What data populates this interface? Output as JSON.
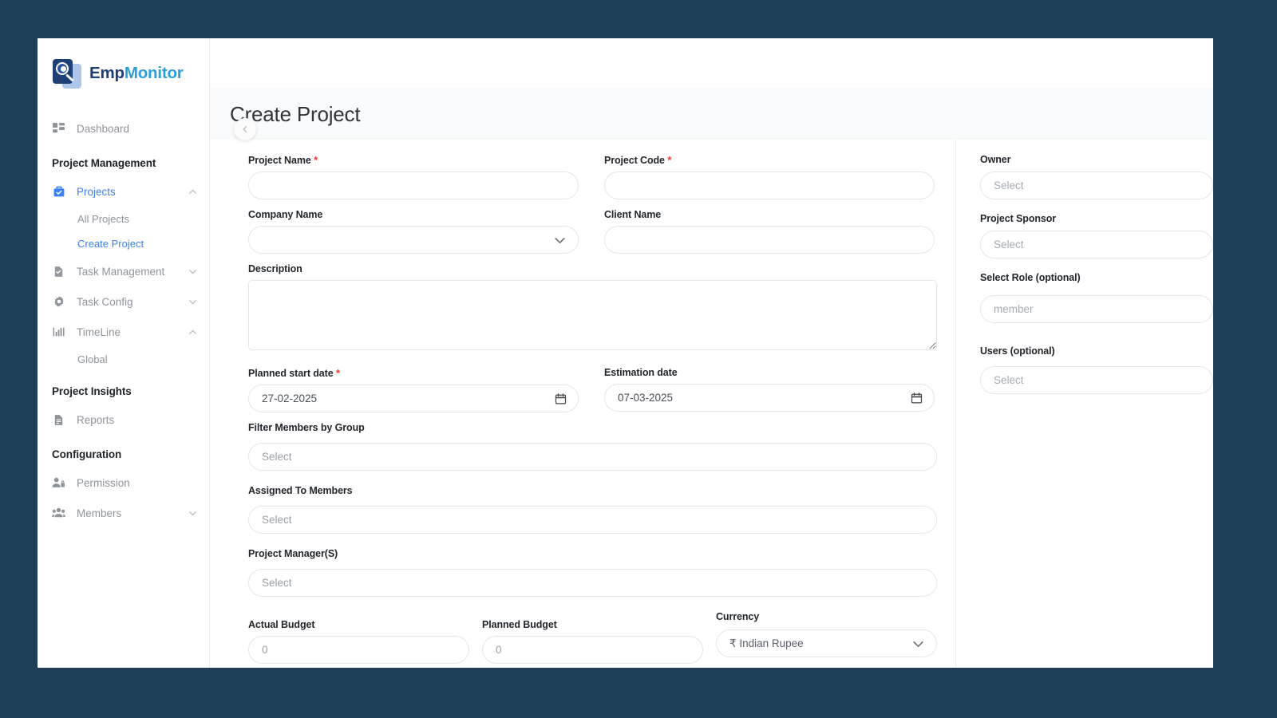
{
  "theme": {
    "outer_background": "#1c4156",
    "accent": "#3b82f6",
    "required_star": "#e8392c",
    "brand_dark": "#1f3f77",
    "brand_light": "#2a9fd8"
  },
  "brand": {
    "name_part1": "Emp",
    "name_part2": "Monitor",
    "logo_icon": "magnifier-person-icon"
  },
  "sidebar": {
    "collapse_icon": "chevron-left-icon",
    "items": [
      {
        "label": "Dashboard",
        "icon": "dashboard-grid-icon",
        "type": "link",
        "active": false,
        "chevron": ""
      }
    ],
    "sections": [
      {
        "title": "Project Management",
        "items": [
          {
            "label": "Projects",
            "icon": "briefcase-check-icon",
            "active": true,
            "chevron": "chevron-up-icon"
          },
          {
            "label": "All Projects",
            "sub": true,
            "current": false
          },
          {
            "label": "Create Project",
            "sub": true,
            "current": true
          },
          {
            "label": "Task Management",
            "icon": "document-check-icon",
            "active": false,
            "chevron": "chevron-down-icon"
          },
          {
            "label": "Task Config",
            "icon": "gear-icon",
            "active": false,
            "chevron": "chevron-down-icon"
          },
          {
            "label": "TimeLine",
            "icon": "bar-chart-icon",
            "active": false,
            "chevron": "chevron-up-icon"
          },
          {
            "label": "Global",
            "sub": true,
            "current": false
          }
        ]
      },
      {
        "title": "Project Insights",
        "items": [
          {
            "label": "Reports",
            "icon": "report-document-icon",
            "active": false,
            "chevron": ""
          }
        ]
      },
      {
        "title": "Configuration",
        "items": [
          {
            "label": "Permission",
            "icon": "user-lock-icon",
            "active": false,
            "chevron": ""
          },
          {
            "label": "Members",
            "icon": "users-group-icon",
            "active": false,
            "chevron": "chevron-down-icon"
          }
        ]
      }
    ]
  },
  "page": {
    "title": "Create Project"
  },
  "form": {
    "project_name": {
      "label": "Project Name",
      "required": true,
      "value": "",
      "placeholder": ""
    },
    "project_code": {
      "label": "Project Code",
      "required": true,
      "value": "",
      "placeholder": ""
    },
    "company_name": {
      "label": "Company Name",
      "required": false,
      "value": "",
      "placeholder": "",
      "icon": "chevron-down-icon"
    },
    "client_name": {
      "label": "Client Name",
      "required": false,
      "value": "",
      "placeholder": ""
    },
    "description": {
      "label": "Description",
      "required": false,
      "value": "",
      "placeholder": ""
    },
    "planned_start_date": {
      "label": "Planned start date",
      "required": true,
      "value": "27-02-2025",
      "icon": "calendar-icon"
    },
    "estimation_date": {
      "label": "Estimation date",
      "required": false,
      "value": "07-03-2025",
      "icon": "calendar-icon"
    },
    "filter_members_by_group": {
      "label": "Filter Members by Group",
      "placeholder": "Select",
      "value": ""
    },
    "assigned_to_members": {
      "label": "Assigned To Members",
      "placeholder": "Select",
      "value": ""
    },
    "project_managers": {
      "label": "Project Manager(S)",
      "placeholder": "Select",
      "value": ""
    },
    "actual_budget": {
      "label": "Actual Budget",
      "placeholder": "0",
      "value": ""
    },
    "planned_budget": {
      "label": "Planned Budget",
      "placeholder": "0",
      "value": ""
    },
    "currency": {
      "label": "Currency",
      "value": "₹ Indian Rupee",
      "icon": "chevron-down-icon"
    }
  },
  "side_panel": {
    "owner": {
      "label": "Owner",
      "placeholder": "Select",
      "value": ""
    },
    "project_sponsor": {
      "label": "Project Sponsor",
      "placeholder": "Select",
      "value": ""
    },
    "select_role": {
      "label": "Select Role (optional)",
      "placeholder": "member",
      "value": ""
    },
    "users": {
      "label": "Users (optional)",
      "placeholder": "Select",
      "value": ""
    }
  }
}
